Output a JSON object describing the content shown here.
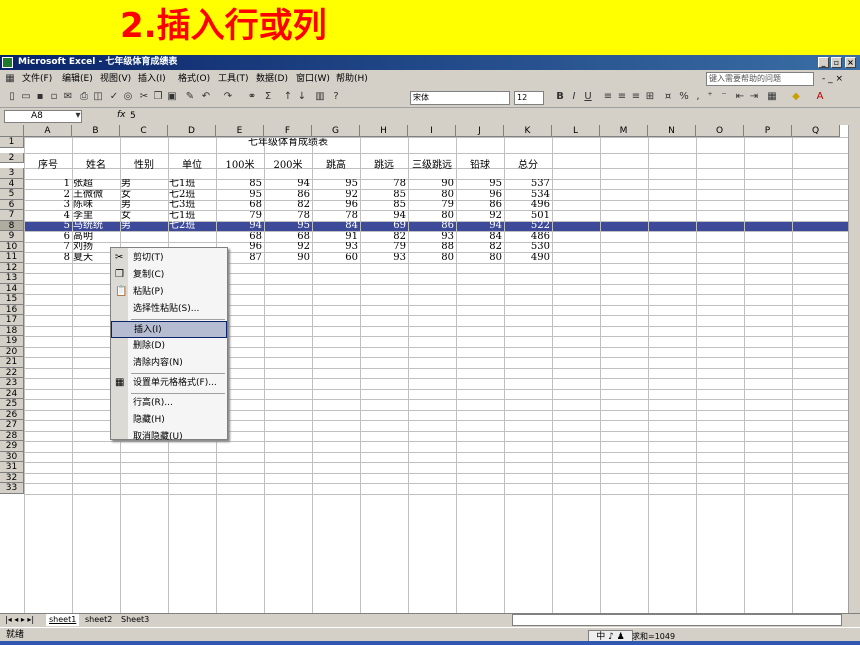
{
  "slide": {
    "title": "2.插入行或列"
  },
  "window": {
    "title": "Microsoft Excel - 七年级体育成绩表",
    "minimize": "_",
    "restore": "▫",
    "close": "×"
  },
  "menubar": {
    "items": [
      "文件(F)",
      "编辑(E)",
      "视图(V)",
      "插入(I)",
      "格式(O)",
      "工具(T)",
      "数据(D)",
      "窗口(W)",
      "帮助(H)"
    ],
    "help_placeholder": "键入需要帮助的问题",
    "doc_controls": "- _ ×"
  },
  "toolbar": {
    "font_name": "宋体",
    "font_size": "12",
    "bold": "B",
    "italic": "I",
    "underline": "U"
  },
  "formula_bar": {
    "name_box": "A8",
    "fx": "fx",
    "value": "5"
  },
  "columns": [
    "A",
    "B",
    "C",
    "D",
    "E",
    "F",
    "G",
    "H",
    "I",
    "J",
    "K",
    "L",
    "M",
    "N",
    "O",
    "P",
    "Q"
  ],
  "rows": [
    "1",
    "2",
    "3",
    "4",
    "5",
    "6",
    "7",
    "8",
    "9",
    "10",
    "11",
    "12",
    "13",
    "14",
    "15",
    "16",
    "17",
    "18",
    "19",
    "20",
    "21",
    "22",
    "23",
    "24",
    "25",
    "26",
    "27",
    "28",
    "29",
    "30",
    "31",
    "32",
    "33"
  ],
  "sheet": {
    "title": "七年级体育成绩表",
    "headers": [
      "序号",
      "姓名",
      "性别",
      "单位",
      "100米",
      "200米",
      "跳高",
      "跳远",
      "三级跳远",
      "铅球",
      "总分"
    ],
    "data_rows": [
      [
        "1",
        "张超",
        "男",
        "七1班",
        "85",
        "94",
        "95",
        "78",
        "90",
        "95",
        "537"
      ],
      [
        "2",
        "王微微",
        "女",
        "七2班",
        "95",
        "86",
        "92",
        "85",
        "80",
        "96",
        "534"
      ],
      [
        "3",
        "陈味",
        "男",
        "七3班",
        "68",
        "82",
        "96",
        "85",
        "79",
        "86",
        "496"
      ],
      [
        "4",
        "李里",
        "女",
        "七1班",
        "79",
        "78",
        "78",
        "94",
        "80",
        "92",
        "501"
      ],
      [
        "5",
        "马统统",
        "男",
        "七2班",
        "94",
        "95",
        "84",
        "69",
        "86",
        "94",
        "522"
      ],
      [
        "6",
        "高明",
        "",
        "",
        "68",
        "68",
        "91",
        "82",
        "93",
        "84",
        "486"
      ],
      [
        "7",
        "刘扬",
        "",
        "",
        "96",
        "92",
        "93",
        "79",
        "88",
        "82",
        "530"
      ],
      [
        "8",
        "夏天",
        "",
        "",
        "87",
        "90",
        "60",
        "93",
        "80",
        "80",
        "490"
      ]
    ]
  },
  "context_menu": {
    "items": [
      {
        "label": "剪切(T)",
        "icon": "scissors-icon",
        "glyph": "✂"
      },
      {
        "label": "复制(C)",
        "icon": "copy-icon",
        "glyph": "❐"
      },
      {
        "label": "粘贴(P)",
        "icon": "paste-icon",
        "glyph": "📋"
      },
      {
        "label": "选择性粘贴(S)...",
        "icon": "",
        "glyph": ""
      },
      {
        "label": "插入(I)",
        "icon": "",
        "glyph": "",
        "selected": true
      },
      {
        "label": "删除(D)",
        "icon": "",
        "glyph": ""
      },
      {
        "label": "清除内容(N)",
        "icon": "",
        "glyph": ""
      },
      {
        "label": "设置单元格格式(F)...",
        "icon": "format-cells-icon",
        "glyph": "▦"
      },
      {
        "label": "行高(R)...",
        "icon": "",
        "glyph": ""
      },
      {
        "label": "隐藏(H)",
        "icon": "",
        "glyph": ""
      },
      {
        "label": "取消隐藏(U)",
        "icon": "",
        "glyph": ""
      }
    ]
  },
  "sheet_tabs": [
    "sheet1",
    "sheet2",
    "Sheet3"
  ],
  "status": {
    "ready": "就绪",
    "ime": "中 ♪ ♟",
    "sum": "求和=1049"
  },
  "colors": {
    "banner": "#ffff00",
    "title": "#ff0000",
    "selected_row": "#3d4a99"
  }
}
